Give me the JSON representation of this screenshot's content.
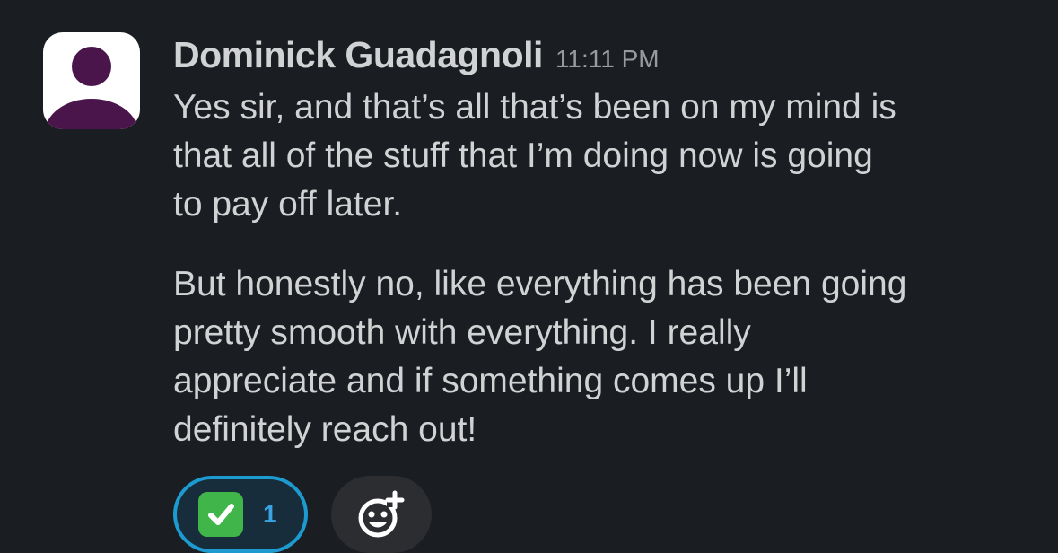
{
  "message": {
    "author": "Dominick Guadagnoli",
    "timestamp": "11:11 PM",
    "paragraphs": [
      {
        "lines": [
          "Yes sir, and that’s all that’s been on my mind is",
          "that all of the stuff that I’m doing now is going",
          "to pay off later."
        ]
      },
      {
        "lines": [
          "But honestly no, like everything has been going",
          "pretty smooth with everything. I really",
          "appreciate and if something comes up I’ll",
          "definitely reach out!"
        ]
      }
    ],
    "avatar": {
      "icon": "default-user-icon",
      "color": "#4a154b"
    }
  },
  "reactions": [
    {
      "emoji": "white-check-mark",
      "count": "1",
      "selected": true
    }
  ],
  "add_reaction": {
    "icon": "add-emoji-icon"
  },
  "colors": {
    "background": "#1a1d21",
    "text": "#d1d2d3",
    "timestamp": "#9a9b9e",
    "reaction_border": "#1d9bd1",
    "reaction_bg": "#172d3b",
    "count": "#3aa3e3",
    "checkmark_bg": "#3fb54a"
  }
}
